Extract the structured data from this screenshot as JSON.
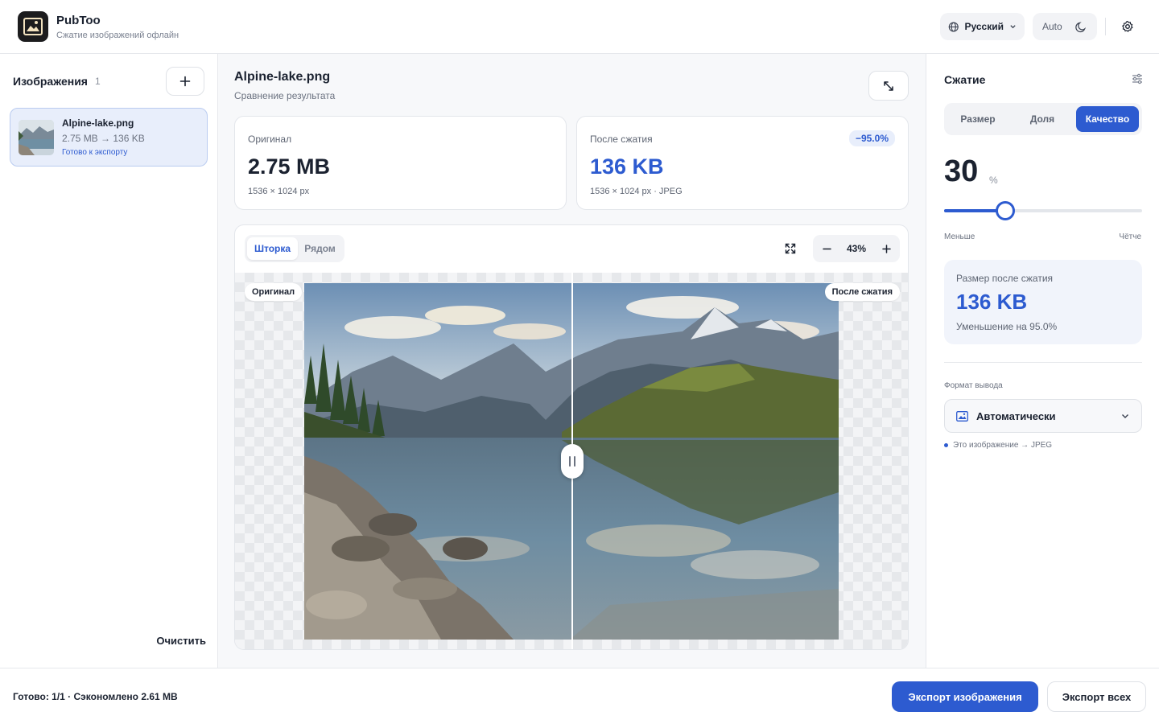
{
  "app": {
    "title": "PubToo",
    "subtitle": "Сжатие изображений офлайн",
    "language": "Русский",
    "theme": "Auto"
  },
  "sidebar": {
    "title": "Изображения",
    "count": "1",
    "files": [
      {
        "name": "Alpine-lake.png",
        "sizes": "2.75 MB → 136 KB",
        "status": "Готово к экспорту"
      }
    ],
    "clear_label": "Очистить"
  },
  "main": {
    "title": "Alpine-lake.png",
    "subtitle": "Сравнение результата",
    "original": {
      "label": "Оригинал",
      "value": "2.75 MB",
      "meta": "1536 × 1024 px"
    },
    "compressed": {
      "label": "После сжатия",
      "value": "136 KB",
      "meta": "1536 × 1024 px · JPEG",
      "badge": "−95.0%"
    },
    "viewer": {
      "modes": [
        "Шторка",
        "Рядом"
      ],
      "active_mode": "Шторка",
      "zoom": "43%",
      "left_tag": "Оригинал",
      "right_tag": "После сжатия",
      "split_fraction": 0.5
    }
  },
  "compression": {
    "title": "Сжатие",
    "modes": [
      "Размер",
      "Доля",
      "Качество"
    ],
    "active_mode": "Качество",
    "quality_value": "30",
    "quality_unit": "%",
    "slider_fraction": 0.31,
    "slider_min_label": "Меньше",
    "slider_max_label": "Чётче",
    "result_label": "Размер после сжатия",
    "result_value": "136 KB",
    "result_note": "Уменьшение на 95.0%",
    "format_label": "Формат вывода",
    "format_value": "Автоматически",
    "format_hint": "Это изображение → JPEG"
  },
  "footer": {
    "status": "Готово: 1/1 · Сэкономлено 2.61 MB",
    "export_label": "Экспорт изображения",
    "export_all_label": "Экспорт всех"
  },
  "colors": {
    "accent": "#2d5bd0",
    "accent_light": "#e8eefb"
  }
}
